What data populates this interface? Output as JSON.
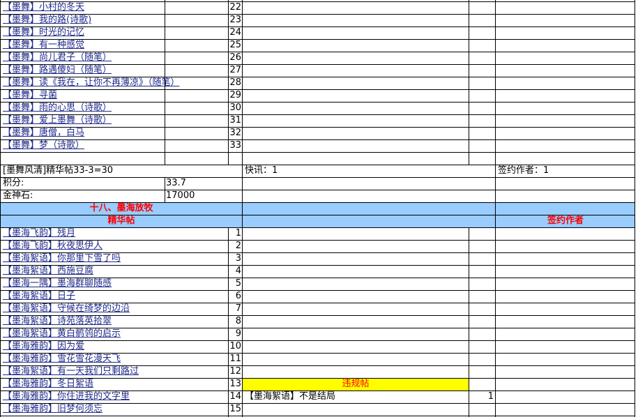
{
  "colors": {
    "header_blue": "#99ccff",
    "violation_yellow": "#ffff00",
    "title_red": "#ff0000",
    "link_blue": "#1f2a8a"
  },
  "section1": {
    "rows": [
      {
        "title": "【墨舞】小村的冬天",
        "num": "22"
      },
      {
        "title": "【墨舞】我的路(诗歌)",
        "num": "23"
      },
      {
        "title": "【墨舞】时光的记忆",
        "num": "24"
      },
      {
        "title": "【墨舞】有一种感觉",
        "num": "25"
      },
      {
        "title": "【墨舞】尚儿君子（随笔）",
        "num": "26"
      },
      {
        "title": "【墨舞】路遇傻妇（随笔）",
        "num": "27"
      },
      {
        "title": "【墨舞】读《我在，让你不再薄凉》（随笔）",
        "num": "28"
      },
      {
        "title": "【墨舞】寻菌",
        "num": "29"
      },
      {
        "title": "【墨舞】雨的心思（诗歌）",
        "num": "30"
      },
      {
        "title": "【墨舞】爱上墨舞（诗歌）",
        "num": "31"
      },
      {
        "title": "【墨舞】唐僧，白马",
        "num": "32"
      },
      {
        "title": "【墨舞】梦（诗歌）",
        "num": "33"
      }
    ],
    "summary": "[墨舞风清]精华帖33-3=30",
    "news": "快讯：1",
    "signed": "签约作者：1",
    "score_label": "积分:",
    "score_value": "33.7",
    "gold_label": "金神石:",
    "gold_value": "17000"
  },
  "section2": {
    "title": "十八、墨海放牧",
    "essence_header": "精华帖",
    "signed_header": "签约作者",
    "rows": [
      {
        "title": "【墨海飞韵】残月",
        "num": "1"
      },
      {
        "title": "【墨海飞韵】秋夜思伊人",
        "num": "2"
      },
      {
        "title": "【墨海絮语】你那里下雪了吗",
        "num": "3"
      },
      {
        "title": "【墨海絮语】西施豆腐",
        "num": "4"
      },
      {
        "title": "【墨海一隅】墨海群聊随感",
        "num": "5"
      },
      {
        "title": "【墨海絮语】日子",
        "num": "6"
      },
      {
        "title": "【墨海絮语】守候在绮梦的边沿",
        "num": "7"
      },
      {
        "title": "【墨海絮语】诗苑落英拾翠",
        "num": "8"
      },
      {
        "title": "【墨海絮语】黄白鹡鸰的启示",
        "num": "9"
      },
      {
        "title": "【墨海雅韵】因为爱",
        "num": "10"
      },
      {
        "title": "【墨海雅韵】雪花雪花漫天飞",
        "num": "11"
      },
      {
        "title": "【墨海絮语】有一天我们只剩路过",
        "num": "12"
      },
      {
        "title": "【墨海雅韵】冬日絮语",
        "num": "13"
      },
      {
        "title": "【墨海雅韵】你住进我的文字里",
        "num": "14"
      },
      {
        "title": "【墨海雅韵】旧梦何须忘",
        "num": "15"
      }
    ],
    "violation_header": "违规帖",
    "violation_title": "【墨海絮语】不是结局",
    "violation_num": "1"
  }
}
